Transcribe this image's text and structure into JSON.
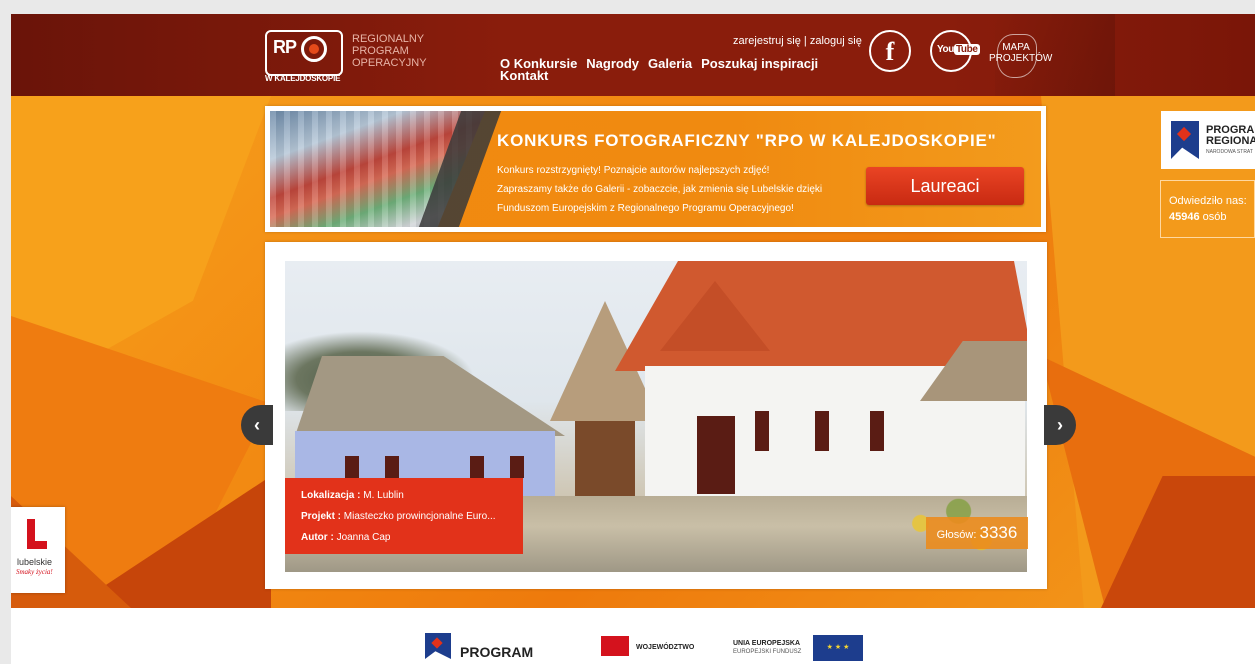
{
  "brand": {
    "logo_text": "RP",
    "logo_subtitle": "W KALEJDOSKOPIE",
    "program_label": "REGIONALNY PROGRAM OPERACYJNY",
    "accent_color": "#8a1d0c",
    "orange_color": "#f28a12"
  },
  "auth": {
    "register": "zarejestruj się",
    "separator": "|",
    "login": "zaloguj się"
  },
  "nav": {
    "items": [
      "O Konkursie",
      "Nagrody",
      "Galeria",
      "Poszukaj inspiracji",
      "Kontakt"
    ]
  },
  "social": {
    "facebook": "f",
    "youtube_you": "You",
    "youtube_tube": "Tube",
    "mapa_line1": "MAPA",
    "mapa_line2": "PROJEKTÓW"
  },
  "contest": {
    "title": "KONKURS FOTOGRAFICZNY \"RPO W KALEJDOSKOPIE\"",
    "desc_line1": "Konkurs rozstrzygnięty! Poznajcie autorów najlepszych zdjęć!",
    "desc_line2": "Zapraszamy także do Galerii - zobaczcie, jak zmienia się Lubelskie dzięki",
    "desc_line3": "Funduszom Europejskim z Regionalnego Programu Operacyjnego!",
    "button": "Laureaci"
  },
  "slider": {
    "prev": "‹",
    "next": "›",
    "location_label": "Lokalizacja :",
    "location_value": "M. Lublin",
    "project_label": "Projekt :",
    "project_value": "Miasteczko prowincjonalne Euro...",
    "author_label": "Autor :",
    "author_value": "Joanna Cap",
    "votes_label": "Głosów:",
    "votes_value": "3336"
  },
  "side": {
    "logo_line1": "PROGRAM",
    "logo_line2": "REGIONAL",
    "logo_sub": "NARODOWA STRAT",
    "visits_label": "Odwiedziło nas:",
    "visits_count": "45946",
    "visits_unit": "osób"
  },
  "lubelskie": {
    "name": "lubelskie",
    "slogan": "Smaky życia!"
  },
  "footer": {
    "program": "PROGRAM",
    "wojewodztwo": "WOJEWÓDZTWO",
    "ue_line1": "UNIA EUROPEJSKA",
    "ue_line2": "EUROPEJSKI FUNDUSZ",
    "eu_stars": "★ ★ ★"
  }
}
